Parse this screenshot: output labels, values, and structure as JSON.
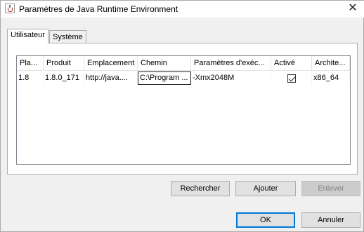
{
  "window": {
    "title": "Paramètres de Java Runtime Environment",
    "close_glyph": "✕"
  },
  "tabs": [
    {
      "label": "Utilisateur",
      "active": true
    },
    {
      "label": "Système",
      "active": false
    }
  ],
  "table": {
    "columns": [
      "Pla...",
      "Produit",
      "Emplacement",
      "Chemin",
      "Paramètres d'exéc...",
      "Activé",
      "Archite..."
    ],
    "rows": [
      {
        "platform": "1.8",
        "product": "1.8.0_171",
        "location": "http://java....",
        "path": "C:\\Program ...",
        "params": "-Xmx2048M",
        "enabled": true,
        "arch": "x86_64"
      }
    ]
  },
  "buttons": {
    "search": "Rechercher",
    "add": "Ajouter",
    "remove": "Enlever",
    "ok": "OK",
    "cancel": "Annuler"
  },
  "colors": {
    "accent": "#0078d7",
    "window_bg": "#f0f0f0"
  }
}
